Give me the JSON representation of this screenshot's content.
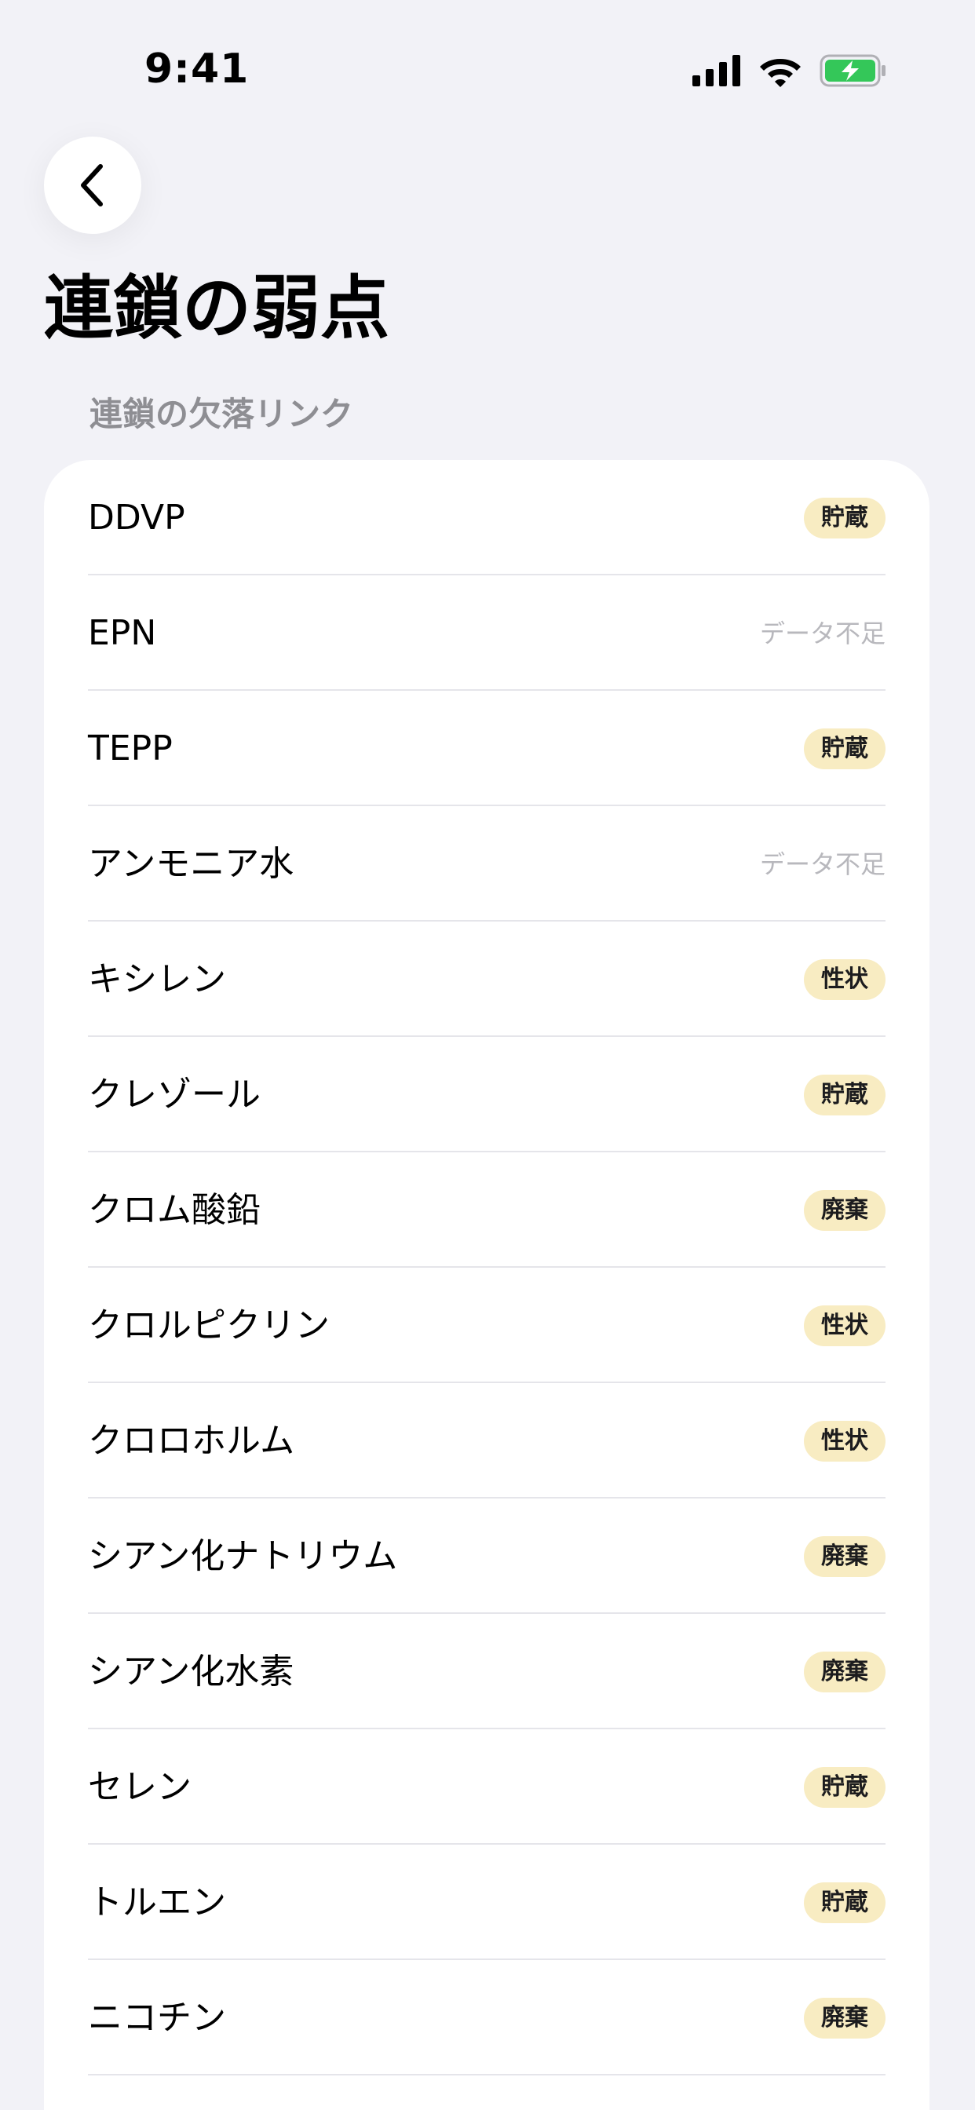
{
  "status_bar": {
    "time": "9:41",
    "icons": [
      "signal-icon",
      "wifi-icon",
      "battery-charging-icon"
    ],
    "battery_color": "#34c759"
  },
  "header": {
    "back_icon": "chevron-left-icon",
    "title": "連鎖の弱点"
  },
  "section": {
    "header": "連鎖の欠落リンク"
  },
  "colors": {
    "background": "#f2f2f7",
    "card": "#ffffff",
    "badge_bg": "#f8ecc2",
    "muted_text": "#b8b8bd",
    "section_header": "#8e8e93"
  },
  "items": [
    {
      "name": "DDVP",
      "status": "貯蔵",
      "kind": "badge"
    },
    {
      "name": "EPN",
      "status": "データ不足",
      "kind": "none"
    },
    {
      "name": "TEPP",
      "status": "貯蔵",
      "kind": "badge"
    },
    {
      "name": "アンモニア水",
      "status": "データ不足",
      "kind": "none"
    },
    {
      "name": "キシレン",
      "status": "性状",
      "kind": "badge"
    },
    {
      "name": "クレゾール",
      "status": "貯蔵",
      "kind": "badge"
    },
    {
      "name": "クロム酸鉛",
      "status": "廃棄",
      "kind": "badge"
    },
    {
      "name": "クロルピクリン",
      "status": "性状",
      "kind": "badge"
    },
    {
      "name": "クロロホルム",
      "status": "性状",
      "kind": "badge"
    },
    {
      "name": "シアン化ナトリウム",
      "status": "廃棄",
      "kind": "badge"
    },
    {
      "name": "シアン化水素",
      "status": "廃棄",
      "kind": "badge"
    },
    {
      "name": "セレン",
      "status": "貯蔵",
      "kind": "badge"
    },
    {
      "name": "トルエン",
      "status": "貯蔵",
      "kind": "badge"
    },
    {
      "name": "ニコチン",
      "status": "廃棄",
      "kind": "badge"
    }
  ]
}
